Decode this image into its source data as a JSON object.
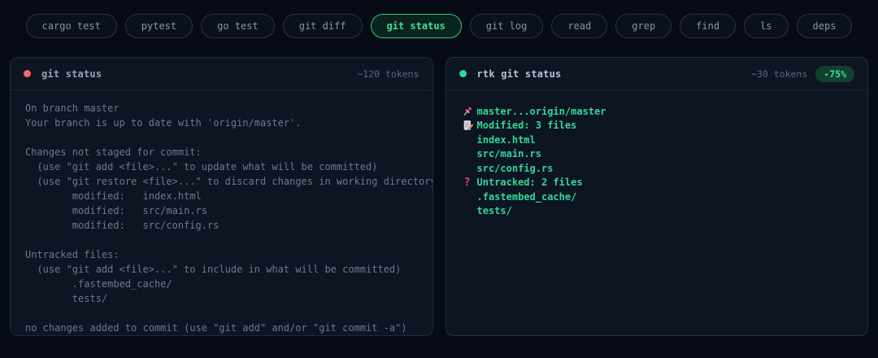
{
  "tabs": {
    "items": [
      {
        "label": "cargo test",
        "active": false
      },
      {
        "label": "pytest",
        "active": false
      },
      {
        "label": "go test",
        "active": false
      },
      {
        "label": "git diff",
        "active": false
      },
      {
        "label": "git status",
        "active": true
      },
      {
        "label": "git log",
        "active": false
      },
      {
        "label": "read",
        "active": false
      },
      {
        "label": "grep",
        "active": false
      },
      {
        "label": "find",
        "active": false
      },
      {
        "label": "ls",
        "active": false
      },
      {
        "label": "deps",
        "active": false
      }
    ]
  },
  "left_panel": {
    "title": "git status",
    "tokens": "~120 tokens",
    "dot_color": "#f4696f",
    "output": "On branch master\nYour branch is up to date with 'origin/master'.\n\nChanges not staged for commit:\n  (use \"git add <file>...\" to update what will be committed)\n  (use \"git restore <file>...\" to discard changes in working directory)\n        modified:   index.html\n        modified:   src/main.rs\n        modified:   src/config.rs\n\nUntracked files:\n  (use \"git add <file>...\" to include in what will be committed)\n        .fastembed_cache/\n        tests/\n\nno changes added to commit (use \"git add\" and/or \"git commit -a\")"
  },
  "right_panel": {
    "title": "rtk git status",
    "tokens": "~30 tokens",
    "badge": "-75%",
    "dot_color": "#2edb95",
    "text_color": "#32d89a",
    "lines": [
      {
        "icon": "pushpin-icon",
        "text": "master...origin/master"
      },
      {
        "icon": "memo-icon",
        "text": "Modified: 3 files"
      },
      {
        "icon": null,
        "text": "index.html"
      },
      {
        "icon": null,
        "text": "src/main.rs"
      },
      {
        "icon": null,
        "text": "src/config.rs"
      },
      {
        "icon": "question-icon",
        "text": "Untracked: 2 files"
      },
      {
        "icon": null,
        "text": ".fastembed_cache/"
      },
      {
        "icon": null,
        "text": "tests/"
      }
    ]
  }
}
